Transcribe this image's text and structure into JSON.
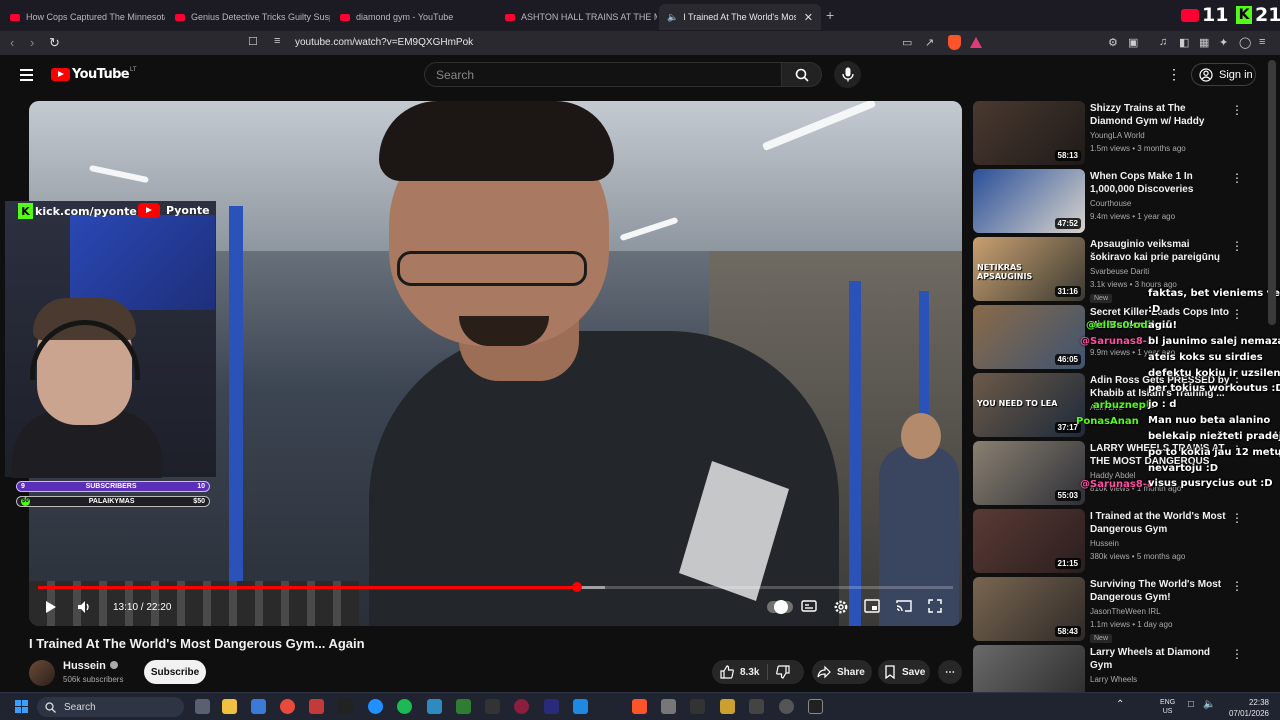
{
  "browser": {
    "tabs": [
      {
        "title": "How Cops Captured The Minnesota",
        "active": false
      },
      {
        "title": "Genius Detective Tricks Guilty Suspe",
        "active": false
      },
      {
        "title": "diamond gym - YouTube",
        "active": false
      },
      {
        "title": "ASHTON HALL TRAINS AT THE MOST",
        "active": false
      },
      {
        "title": "I Trained At The World's Most",
        "active": true
      }
    ],
    "url": "youtube.com/watch?v=EM9QXGHmPok"
  },
  "overlay_counts": {
    "youtube": "11",
    "kick": "21"
  },
  "header": {
    "logo_text": "YouTube",
    "country_code": "LT",
    "search_placeholder": "Search",
    "signin_label": "Sign in"
  },
  "stream_overlay": {
    "kick_label": "kick.com/pyonte",
    "youtube_label": "Pyonte",
    "sub_goal": {
      "start": "9",
      "label": "SUBSCRIBERS",
      "end": "10"
    },
    "donation_goal": {
      "start": "$0",
      "label": "PALAIKYMAS",
      "end": "$50"
    }
  },
  "player": {
    "current_time": "13:10",
    "duration": "22:20",
    "played_fraction": 0.5896,
    "buffered_fraction": 0.62,
    "autoplay_on": true
  },
  "video": {
    "title": "I Trained At The World's Most Dangerous Gym... Again",
    "channel": "Hussein",
    "subscribers": "506k subscribers",
    "subscribe_label": "Subscribe",
    "likes": "8.3k",
    "share_label": "Share",
    "save_label": "Save"
  },
  "recommendations": [
    {
      "title": "Shizzy Trains at The Diamond Gym w/ Haddy Abdel",
      "channel": "YoungLA World",
      "meta": "1.5m views • 3 months ago",
      "duration": "58:13",
      "new": "",
      "colors": [
        "#4a3a30",
        "#1e1a18"
      ]
    },
    {
      "title": "When Cops Make 1 In 1,000,000 Discoveries",
      "channel": "Courthouse",
      "meta": "9.4m views • 1 year ago",
      "duration": "47:52",
      "new": "",
      "colors": [
        "#2a4f9a",
        "#d8d4cc"
      ]
    },
    {
      "title": "Apsauginio veiksmai šokiravo kai prie pareigūnų akių buvo ...",
      "channel": "Svarbeuse Dariti",
      "meta": "3.1k views • 3 hours ago",
      "duration": "31:16",
      "new": "New",
      "colors": [
        "#c9a070",
        "#3a3a32"
      ],
      "thumb_text": "NETIKRAS APSAUGINIS"
    },
    {
      "title": "Secret Killer Leads Cops Into His Murder Shed",
      "channel": "",
      "meta": "9.9m views • 1 year ago",
      "duration": "46:05",
      "new": "",
      "colors": [
        "#8a6a48",
        "#3e5470"
      ]
    },
    {
      "title": "Adin Ross Gets PRESSED by Khabib at Islam's Training ...",
      "channel": "Adin Live",
      "meta": "",
      "duration": "37:17",
      "new": "",
      "colors": [
        "#6c5a48",
        "#1e2a3a"
      ],
      "thumb_text": "YOU NEED TO LEA"
    },
    {
      "title": "LARRY WHEELS TRAINS AT THE MOST DANGEROUS GYM ...",
      "channel": "Haddy Abdel",
      "meta": "816k views • 1 month ago",
      "duration": "55:03",
      "new": "",
      "colors": [
        "#8a8070",
        "#2e3038"
      ]
    },
    {
      "title": "I Trained at the World's Most Dangerous Gym",
      "channel": "Hussein",
      "meta": "380k views • 5 months ago",
      "duration": "21:15",
      "new": "",
      "colors": [
        "#5a3a34",
        "#2a1e1e"
      ]
    },
    {
      "title": "Surviving The World's Most Dangerous Gym!",
      "channel": "JasonTheWeen IRL",
      "meta": "1.1m views • 1 day ago",
      "duration": "58:43",
      "new": "New",
      "colors": [
        "#7a6650",
        "#2e2a28"
      ]
    },
    {
      "title": "Larry Wheels at Diamond Gym",
      "channel": "Larry Wheels",
      "meta": "",
      "duration": "",
      "new": "",
      "colors": [
        "#6a6a6a",
        "#2a2a2a"
      ]
    }
  ],
  "chat": [
    {
      "text": "faktas, bet vieniems veikia",
      "user": ""
    },
    {
      "text": ":D",
      "user": ""
    },
    {
      "text": "agiū!",
      "user": "@ell3s0-odb"
    },
    {
      "text": "bl jaunimo salej nemazai,",
      "user": "@Sarunas8-8"
    },
    {
      "text": "ateis koks su sirdies",
      "user": ""
    },
    {
      "text": "defektu kokiu ir uzsilenks",
      "user": ""
    },
    {
      "text": "per tokius workoutus :D",
      "user": ""
    },
    {
      "text": "jo : d",
      "user": "arbuzneplt"
    },
    {
      "text": "Man nuo beta alanino",
      "user": "PonasAnan"
    },
    {
      "text": "belekaip niežteti pradėjo,",
      "user": ""
    },
    {
      "text": "po to kokia jau 12 metų",
      "user": ""
    },
    {
      "text": "nevartoju :D",
      "user": ""
    },
    {
      "text": "visus pusrycius out :D",
      "user": "@Sarunas8-8"
    }
  ],
  "taskbar": {
    "search_placeholder": "Search",
    "lang_top": "ENG",
    "lang_bottom": "US",
    "time": "22:38",
    "date": "07/01/2026"
  }
}
